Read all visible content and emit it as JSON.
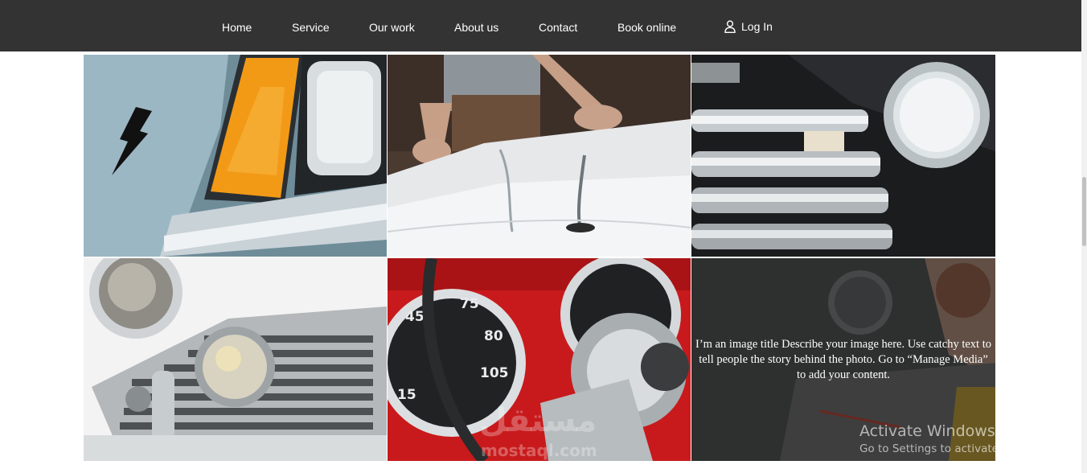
{
  "nav": {
    "items": [
      {
        "label": "Home"
      },
      {
        "label": "Service"
      },
      {
        "label": "Our work"
      },
      {
        "label": "About us"
      },
      {
        "label": "Contact"
      },
      {
        "label": "Book online"
      }
    ],
    "login_label": "Log In",
    "login_icon": "user-icon"
  },
  "gallery": {
    "hover_item": {
      "title": "I’m an image title",
      "description": "Describe your image here. Use catchy text to tell people the story behind the photo. Go to “Manage Media” to add your content."
    }
  },
  "watermarks": {
    "windows_title": "Activate Windows",
    "windows_sub": "Go to Settings to activate Windows.",
    "site_arabic": "مستقل",
    "site_latin": "mostaql.com"
  }
}
